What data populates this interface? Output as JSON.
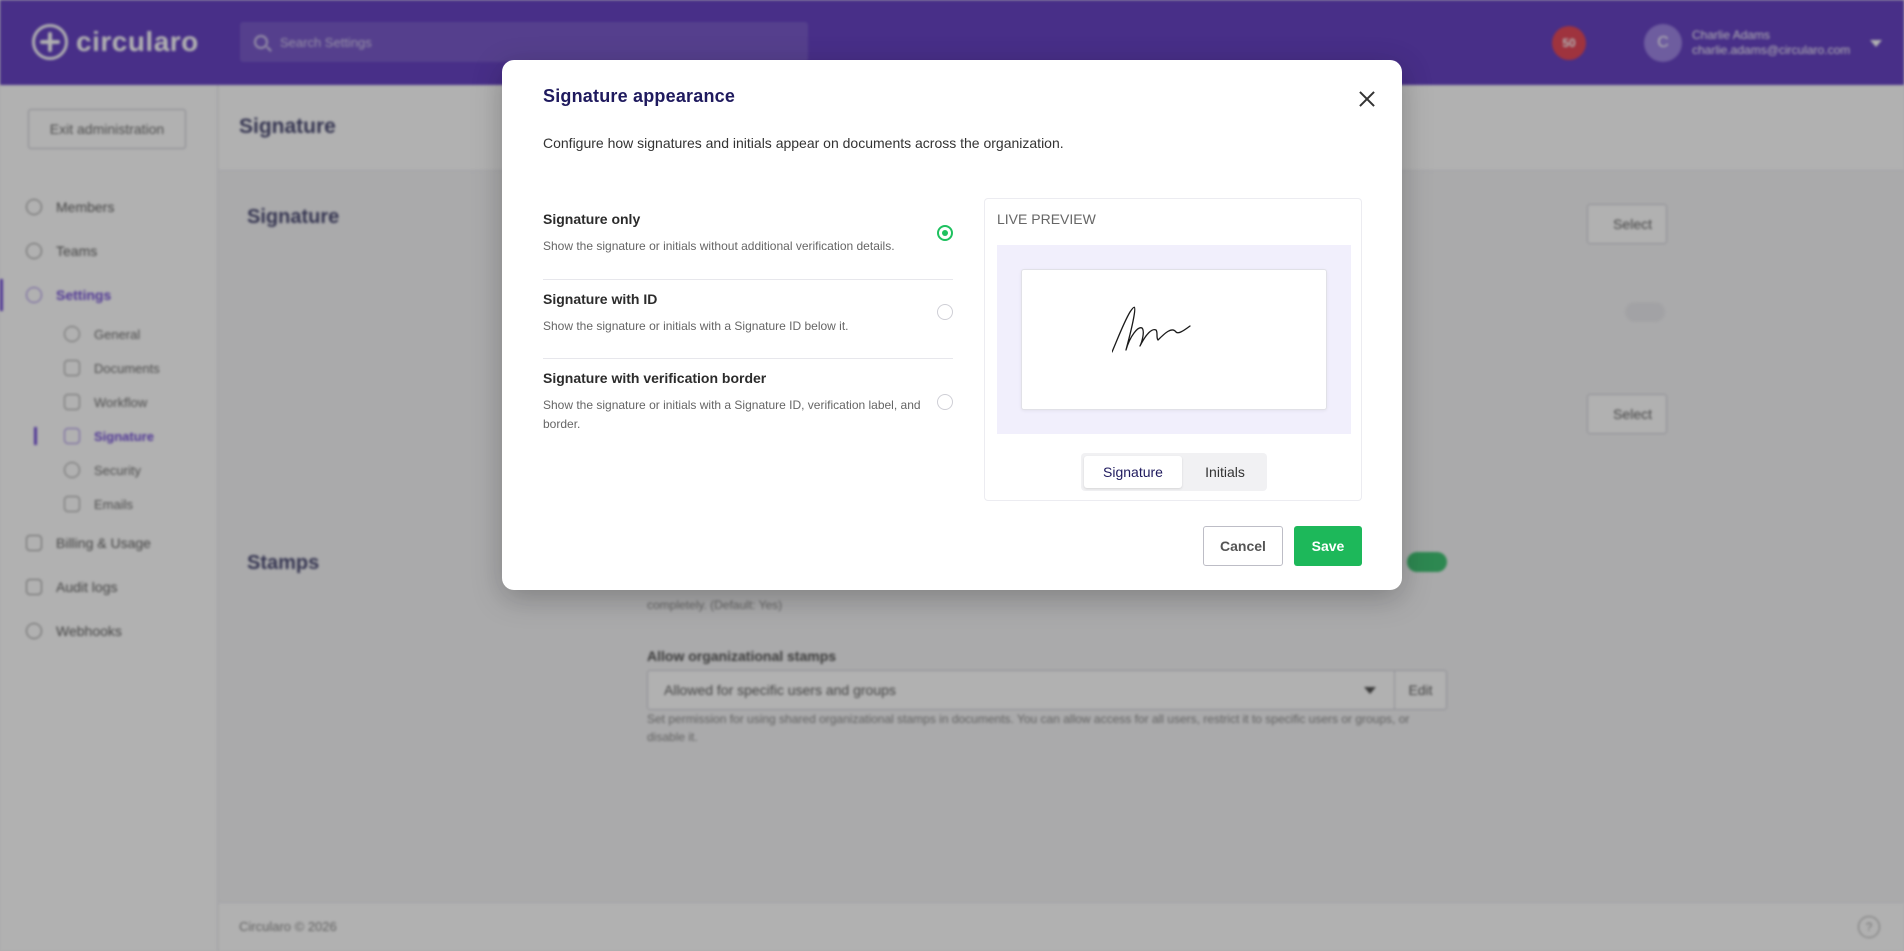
{
  "app": {
    "brand": "circularo",
    "search_placeholder": "Search Settings",
    "notification_count": "50",
    "user": {
      "initial": "C",
      "name": "Charlie Adams",
      "email": "charlie.adams@circularo.com"
    }
  },
  "sidebar": {
    "exit_label": "Exit administration",
    "items": [
      {
        "label": "Members"
      },
      {
        "label": "Teams"
      },
      {
        "label": "Settings"
      },
      {
        "label": "Billing & Usage"
      },
      {
        "label": "Audit logs"
      },
      {
        "label": "Webhooks"
      }
    ],
    "sub_items": [
      {
        "label": "General"
      },
      {
        "label": "Documents"
      },
      {
        "label": "Workflow"
      },
      {
        "label": "Signature"
      },
      {
        "label": "Security"
      },
      {
        "label": "Emails"
      }
    ]
  },
  "page": {
    "title": "Signature",
    "sections": [
      {
        "title": "Signature"
      },
      {
        "title": "Stamps"
      }
    ],
    "select_btn_label": "Select",
    "stamps_help": "completely. (Default: Yes)",
    "org_stamps_label": "Allow organizational stamps",
    "org_stamps_value": "Allowed for specific users and groups",
    "edit_label": "Edit",
    "org_stamps_help": "Set permission for using shared organizational stamps in documents. You can allow access for all users, restrict it to specific users or groups, or disable it.",
    "footer": "Circularo © 2026"
  },
  "modal": {
    "title": "Signature appearance",
    "description": "Configure how signatures and initials appear on documents across the organization.",
    "options": [
      {
        "title": "Signature only",
        "description": "Show the signature or initials without additional verification details.",
        "selected": true
      },
      {
        "title": "Signature with ID",
        "description": "Show the signature or initials with a Signature ID below it.",
        "selected": false
      },
      {
        "title": "Signature with verification border",
        "description": "Show the signature or initials with a Signature ID, verification label, and border.",
        "selected": false
      }
    ],
    "preview_label": "LIVE PREVIEW",
    "preview_tabs": [
      "Signature",
      "Initials"
    ],
    "preview_active_tab": "Signature",
    "cancel_label": "Cancel",
    "save_label": "Save"
  },
  "colors": {
    "brand": "#4a1fb8",
    "accent_green": "#1db85a",
    "title_navy": "#1f1a5e",
    "notification_red": "#e0263a"
  }
}
